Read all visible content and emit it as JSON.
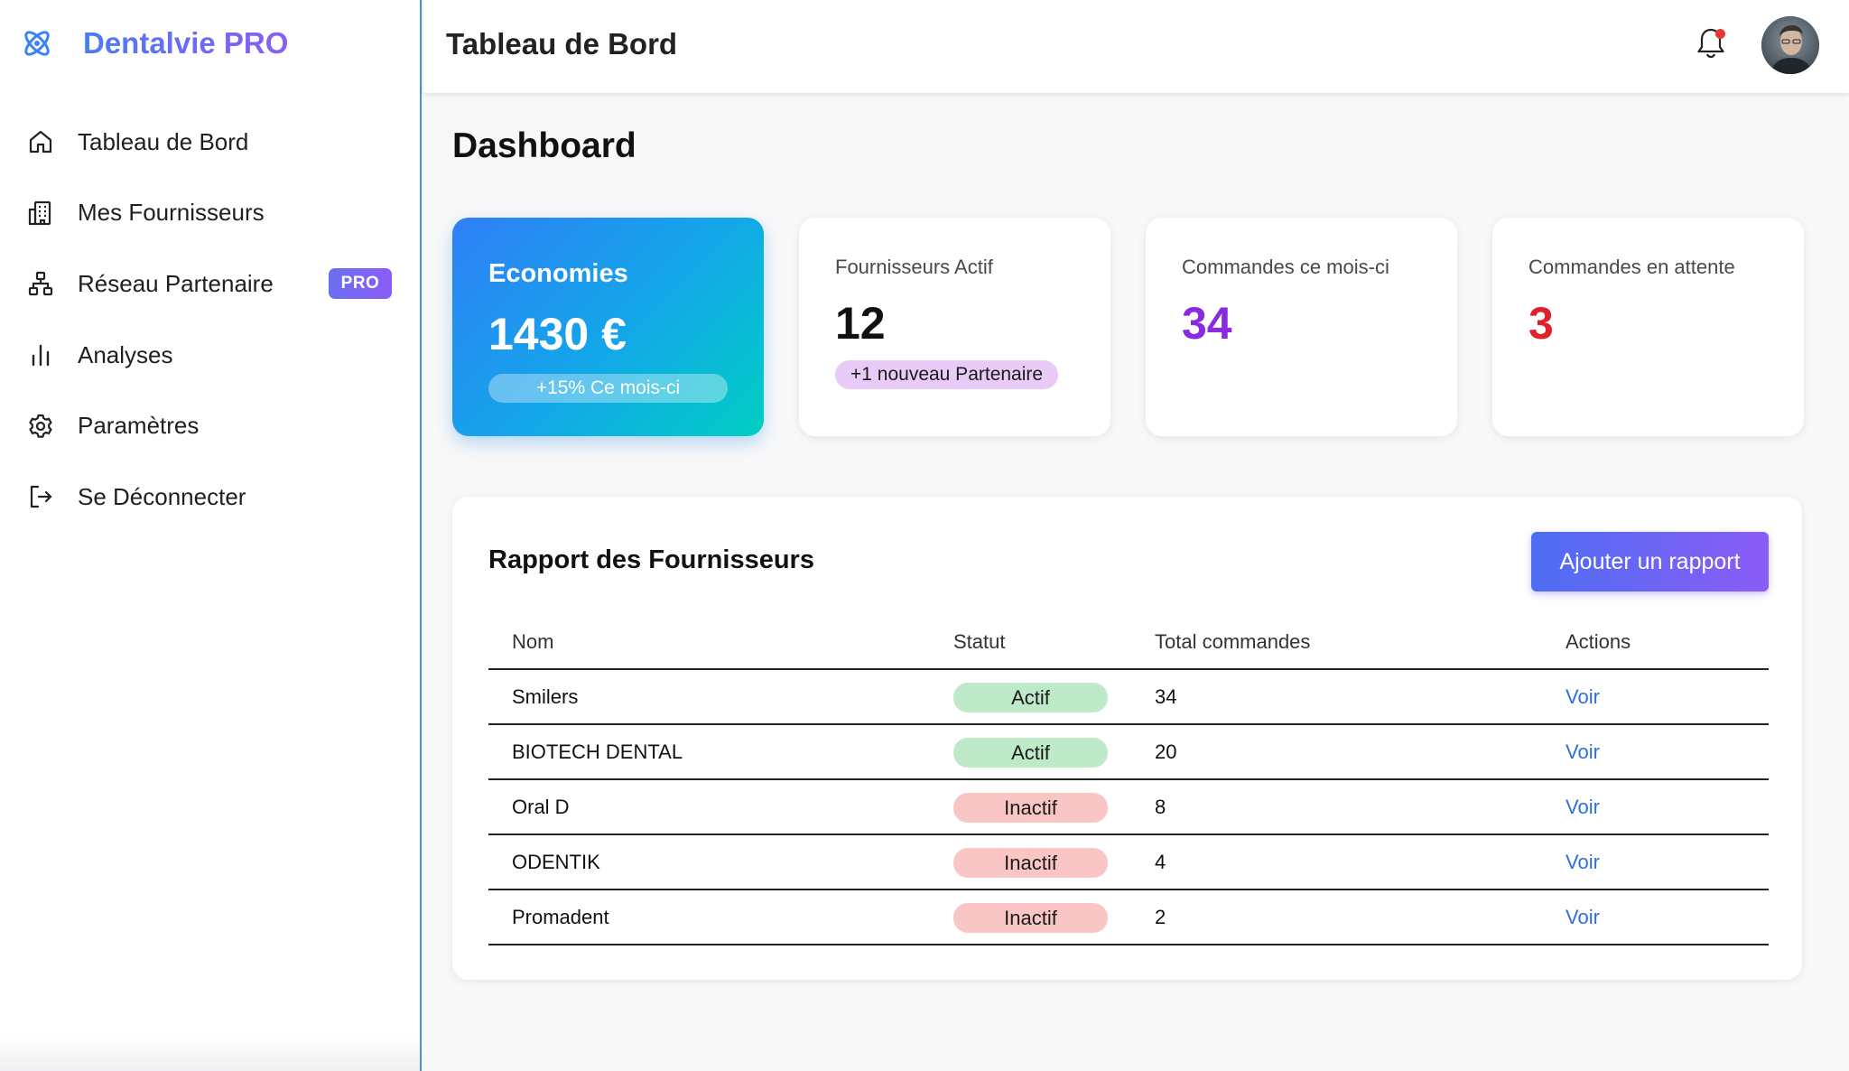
{
  "app": {
    "brand": "Dentalvie PRO",
    "header_title": "Tableau de Bord",
    "brand_color": "#6b6ff0"
  },
  "sidebar": {
    "items": [
      {
        "label": "Tableau de Bord",
        "icon": "home-icon"
      },
      {
        "label": "Mes Fournisseurs",
        "icon": "building-icon"
      },
      {
        "label": "Réseau Partenaire",
        "icon": "network-icon",
        "badge": "PRO"
      },
      {
        "label": "Analyses",
        "icon": "bar-chart-icon"
      },
      {
        "label": "Paramètres",
        "icon": "gear-icon"
      },
      {
        "label": "Se Déconnecter",
        "icon": "logout-icon"
      }
    ]
  },
  "main": {
    "page_title": "Dashboard",
    "cards": {
      "economies": {
        "title": "Economies",
        "value": "1430 €",
        "trend": "+15% Ce mois-ci"
      },
      "fournisseurs": {
        "label": "Fournisseurs Actif",
        "value": "12",
        "pill": "+1 nouveau Partenaire",
        "value_color": "#111111"
      },
      "commandes_mois": {
        "label": "Commandes ce mois-ci",
        "value": "34",
        "value_color": "#8a2be2"
      },
      "commandes_attente": {
        "label": "Commandes en attente",
        "value": "3",
        "value_color": "#e0202a"
      }
    },
    "report": {
      "title": "Rapport des Fournisseurs",
      "add_button": "Ajouter un rapport",
      "columns": [
        "Nom",
        "Statut",
        "Total commandes",
        "Actions"
      ],
      "rows": [
        {
          "nom": "Smilers",
          "statut": "Actif",
          "total": "34",
          "action": "Voir"
        },
        {
          "nom": "BIOTECH DENTAL",
          "statut": "Actif",
          "total": "20",
          "action": "Voir"
        },
        {
          "nom": "Oral D",
          "statut": "Inactif",
          "total": "8",
          "action": "Voir"
        },
        {
          "nom": "ODENTIK",
          "statut": "Inactif",
          "total": "4",
          "action": "Voir"
        },
        {
          "nom": "Promadent",
          "statut": "Inactif",
          "total": "2",
          "action": "Voir"
        }
      ]
    }
  },
  "header": {
    "notification_icon": "bell-icon",
    "has_unread": true,
    "avatar": "user-avatar"
  }
}
